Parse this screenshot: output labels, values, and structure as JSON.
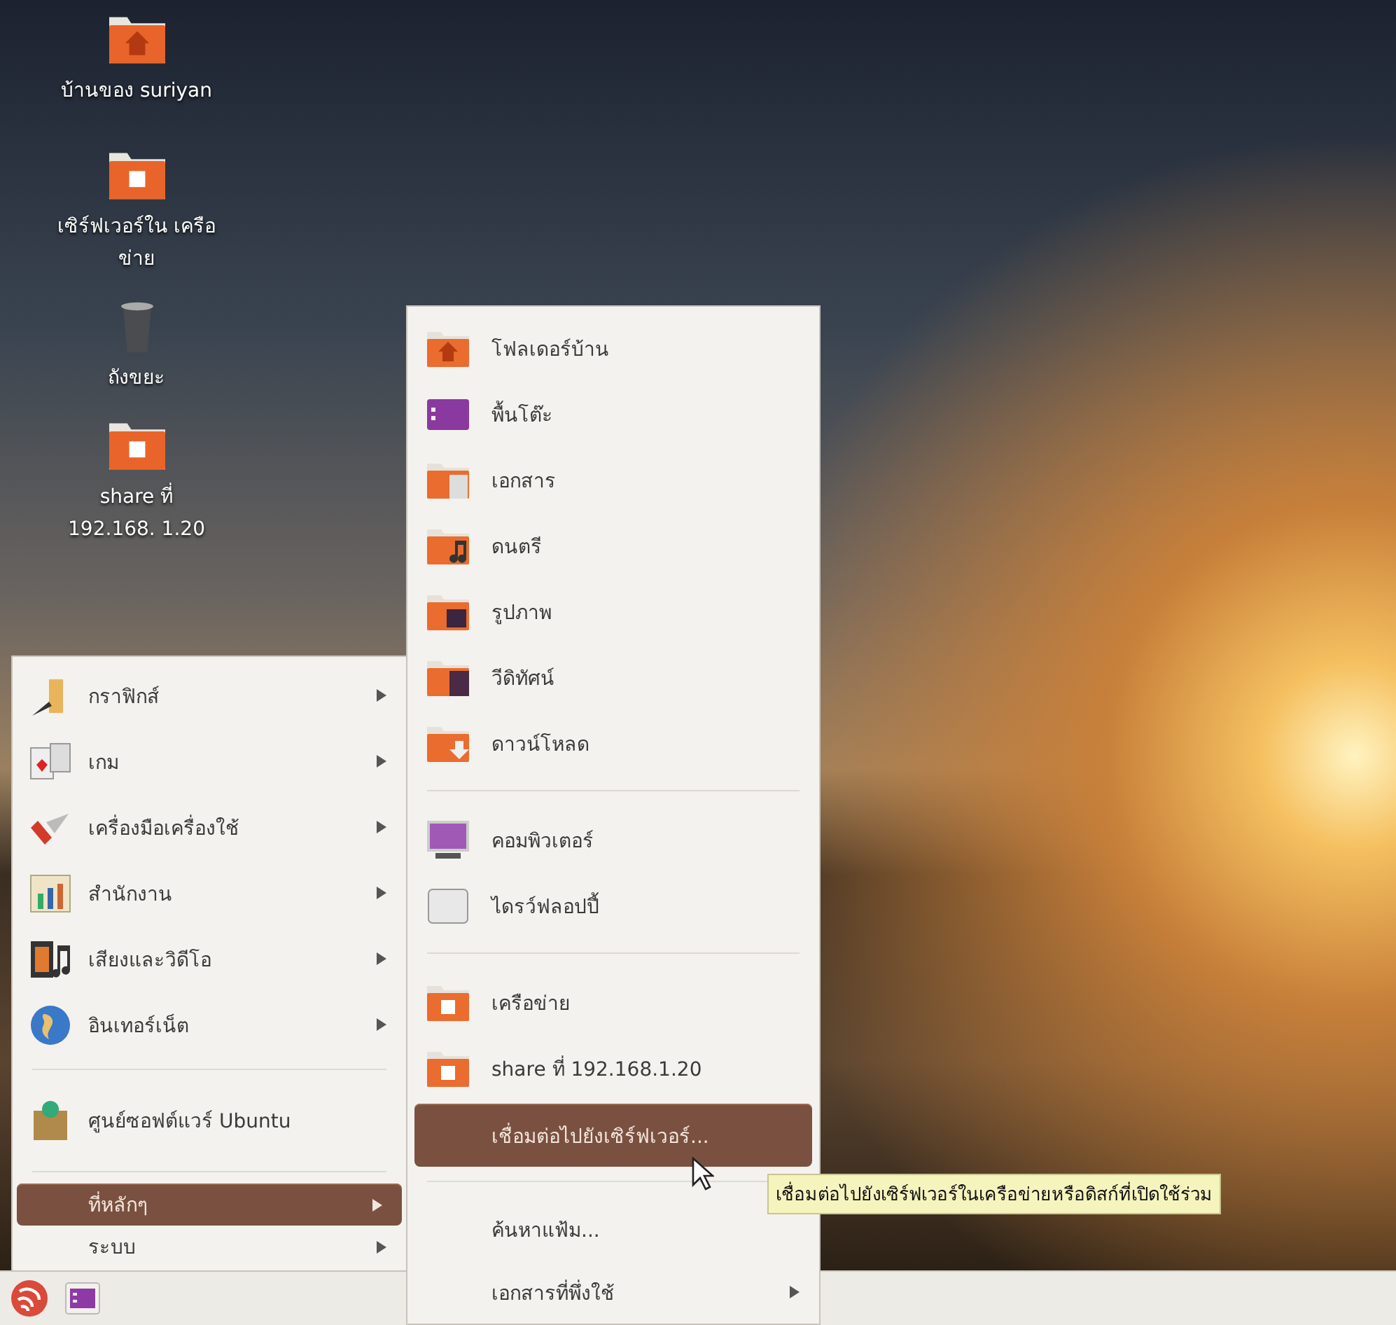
{
  "desktop_icons": [
    {
      "label": "บ้านของ suriyan"
    },
    {
      "label": "เซิร์ฟเวอร์ใน เครือข่าย"
    },
    {
      "label": "ถังขยะ"
    },
    {
      "label": "share ที่ 192.168. 1.20"
    }
  ],
  "main_menu": {
    "items": [
      {
        "kind": "icon-item",
        "label": "กราฟิกส์",
        "submenu": true,
        "selected": false
      },
      {
        "kind": "icon-item",
        "label": "เกม",
        "submenu": true,
        "selected": false
      },
      {
        "kind": "icon-item",
        "label": "เครื่องมือเครื่องใช้",
        "submenu": true,
        "selected": false
      },
      {
        "kind": "icon-item",
        "label": "สำนักงาน",
        "submenu": true,
        "selected": false
      },
      {
        "kind": "icon-item",
        "label": "เสียงและวิดีโอ",
        "submenu": true,
        "selected": false
      },
      {
        "kind": "icon-item",
        "label": "อินเทอร์เน็ต",
        "submenu": true,
        "selected": false
      },
      {
        "kind": "separator"
      },
      {
        "kind": "tall-item",
        "label": "ศูนย์ซอฟต์แวร์ Ubuntu",
        "submenu": false,
        "selected": false
      },
      {
        "kind": "separator"
      },
      {
        "kind": "text-item",
        "label": "ที่หลักๆ",
        "submenu": true,
        "selected": true
      },
      {
        "kind": "text-item",
        "label": "ระบบ",
        "submenu": true,
        "selected": false
      }
    ]
  },
  "places_menu": {
    "items": [
      {
        "kind": "icon-item",
        "label": "โฟลเดอร์บ้าน",
        "submenu": false,
        "selected": false
      },
      {
        "kind": "icon-item",
        "label": "พื้นโต๊ะ",
        "submenu": false,
        "selected": false
      },
      {
        "kind": "icon-item",
        "label": "เอกสาร",
        "submenu": false,
        "selected": false
      },
      {
        "kind": "icon-item",
        "label": "ดนตรี",
        "submenu": false,
        "selected": false
      },
      {
        "kind": "icon-item",
        "label": "รูปภาพ",
        "submenu": false,
        "selected": false
      },
      {
        "kind": "icon-item",
        "label": "วีดิทัศน์",
        "submenu": false,
        "selected": false
      },
      {
        "kind": "icon-item",
        "label": "ดาวน์โหลด",
        "submenu": false,
        "selected": false
      },
      {
        "kind": "separator"
      },
      {
        "kind": "icon-item",
        "label": "คอมพิวเตอร์",
        "submenu": false,
        "selected": false
      },
      {
        "kind": "icon-item",
        "label": "ไดรว์ฟลอปปี้",
        "submenu": false,
        "selected": false
      },
      {
        "kind": "separator"
      },
      {
        "kind": "icon-item",
        "label": "เครือข่าย",
        "submenu": false,
        "selected": false
      },
      {
        "kind": "icon-item",
        "label": "share ที่ 192.168.1.20",
        "submenu": false,
        "selected": false
      },
      {
        "kind": "text-item",
        "label": "เชื่อมต่อไปยังเซิร์ฟเวอร์...",
        "submenu": false,
        "selected": true
      },
      {
        "kind": "separator"
      },
      {
        "kind": "text-item",
        "label": "ค้นหาแฟ้ม...",
        "submenu": false,
        "selected": false
      },
      {
        "kind": "text-item",
        "label": "เอกสารที่พึ่งใช้",
        "submenu": true,
        "selected": false
      }
    ]
  },
  "tooltip": {
    "text": "เชื่อมต่อไปยังเซิร์ฟเวอร์ในเครือข่ายหรือดิสก์ที่เปิดใช้ร่วม"
  }
}
